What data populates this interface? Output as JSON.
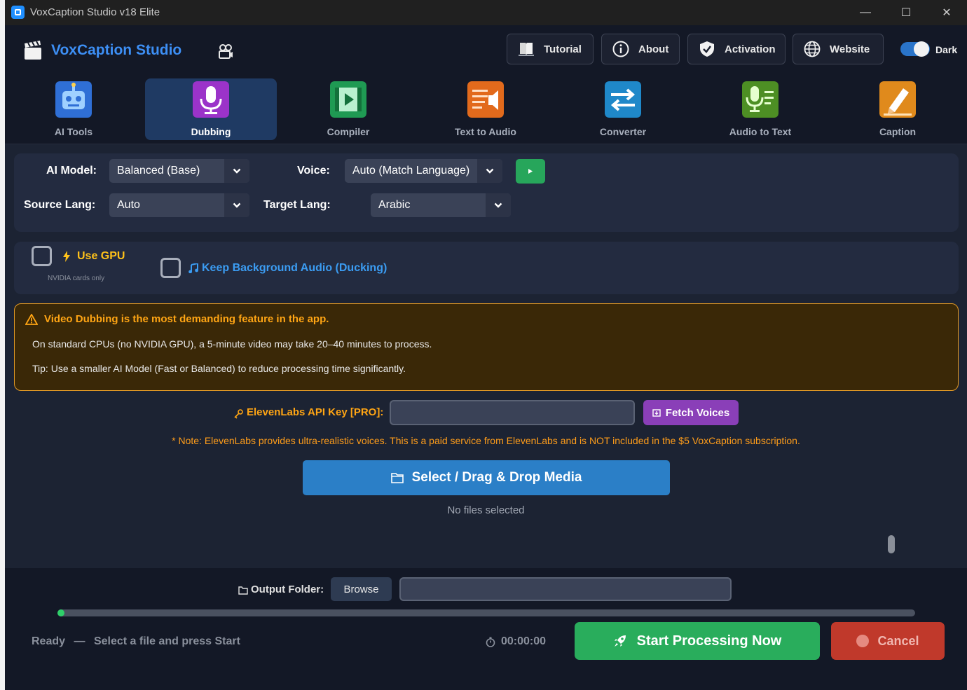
{
  "window": {
    "title": "VoxCaption Studio v18 Elite",
    "controls": [
      "—",
      "☐",
      "✕"
    ]
  },
  "header": {
    "brand": "VoxCaption Studio",
    "buttons": [
      {
        "label": "Tutorial",
        "icon": "book-icon"
      },
      {
        "label": "About",
        "icon": "info-icon"
      },
      {
        "label": "Activation",
        "icon": "shield-check-icon"
      },
      {
        "label": "Website",
        "icon": "globe-icon"
      }
    ],
    "theme_label": "Dark"
  },
  "tabs": [
    {
      "label": "AI Tools",
      "icon": "robot-icon",
      "color": "#2f6fd6"
    },
    {
      "label": "Dubbing",
      "icon": "microphone-icon",
      "color": "#9b33c9",
      "active": true
    },
    {
      "label": "Compiler",
      "icon": "film-play-icon",
      "color": "#1f9a53"
    },
    {
      "label": "Text to Audio",
      "icon": "text-speaker-icon",
      "color": "#e26a1c"
    },
    {
      "label": "Converter",
      "icon": "swap-arrows-icon",
      "color": "#1f88c9"
    },
    {
      "label": "Audio to Text",
      "icon": "mic-text-icon",
      "color": "#4d8f24"
    },
    {
      "label": "Caption",
      "icon": "pencil-icon",
      "color": "#e08a1c"
    }
  ],
  "settings": {
    "ai_model_label": "AI Model:",
    "ai_model_value": "Balanced (Base)",
    "voice_label": "Voice:",
    "voice_value": "Auto (Match Language)",
    "source_lang_label": "Source Lang:",
    "source_lang_value": "Auto",
    "target_lang_label": "Target Lang:",
    "target_lang_value": "Arabic"
  },
  "options": {
    "gpu_label": "Use GPU",
    "gpu_sub": "NVIDIA cards only",
    "bg_audio_label": "Keep Background Audio (Ducking)"
  },
  "warning": {
    "title": "Video Dubbing is the most demanding feature in the app.",
    "line1": "On standard CPUs (no NVIDIA GPU), a 5-minute video may take 20–40 minutes to process.",
    "line2": "Tip: Use a smaller AI Model (Fast or Balanced) to reduce processing time significantly."
  },
  "api": {
    "label": "ElevenLabs API Key [PRO]:",
    "fetch_label": "Fetch Voices",
    "note": "* Note: ElevenLabs provides ultra-realistic voices. This is a paid service from ElevenLabs and is NOT included in the $5 VoxCaption subscription."
  },
  "media": {
    "drop_label": "Select / Drag & Drop Media",
    "status": "No files selected"
  },
  "bottom": {
    "output_label": "Output Folder:",
    "browse_label": "Browse",
    "progress": 0.008,
    "status_ready": "Ready",
    "status_dash": "—",
    "status_hint": "Select a file and press Start",
    "timer": "00:00:00",
    "start_label": "Start Processing Now",
    "cancel_label": "Cancel"
  },
  "colors": {
    "accent": "#3d8ff5",
    "success": "#29ad5c",
    "danger": "#c0392b",
    "warning": "#ffa514",
    "purple": "#8a3fb8"
  }
}
